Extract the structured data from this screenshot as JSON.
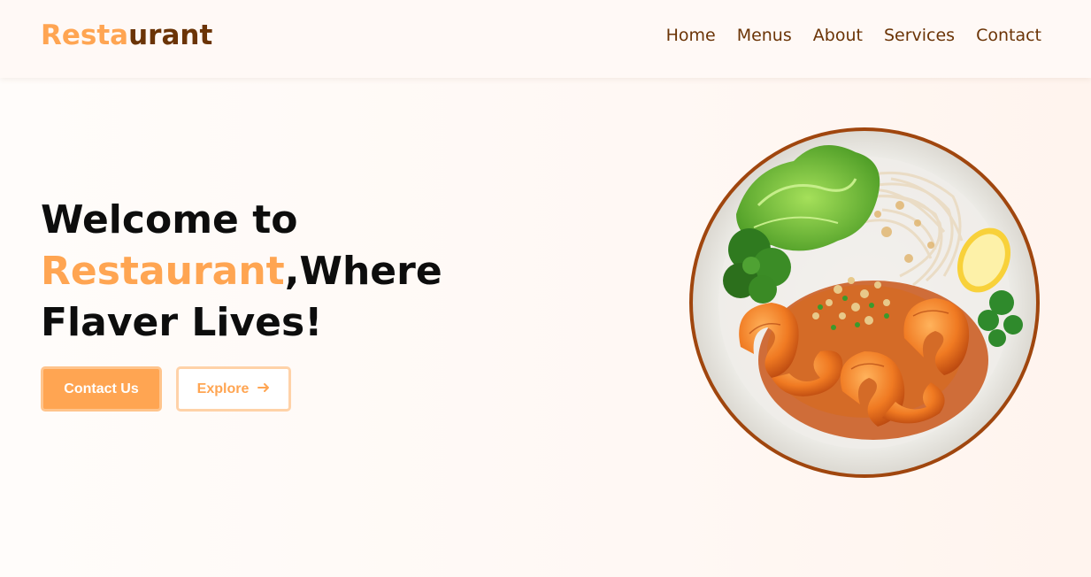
{
  "brand": {
    "logo_part1": "Resta",
    "logo_part2": "urant"
  },
  "nav": {
    "items": [
      {
        "label": "Home"
      },
      {
        "label": "Menus"
      },
      {
        "label": "About"
      },
      {
        "label": "Services"
      },
      {
        "label": "Contact"
      }
    ]
  },
  "hero": {
    "line1": "Welcome to",
    "accent_word": "Restaurant",
    "line2_rest": ",Where",
    "line3": "Flaver Lives!",
    "primary_button": "Contact Us",
    "secondary_button": "Explore",
    "secondary_button_icon": "arrow-right-icon"
  },
  "colors": {
    "accent": "#ffa552",
    "brand_dark": "#6b3406",
    "heading": "#0d0d0d"
  },
  "image": {
    "subject": "plate-of-shrimp-noodles-image"
  }
}
